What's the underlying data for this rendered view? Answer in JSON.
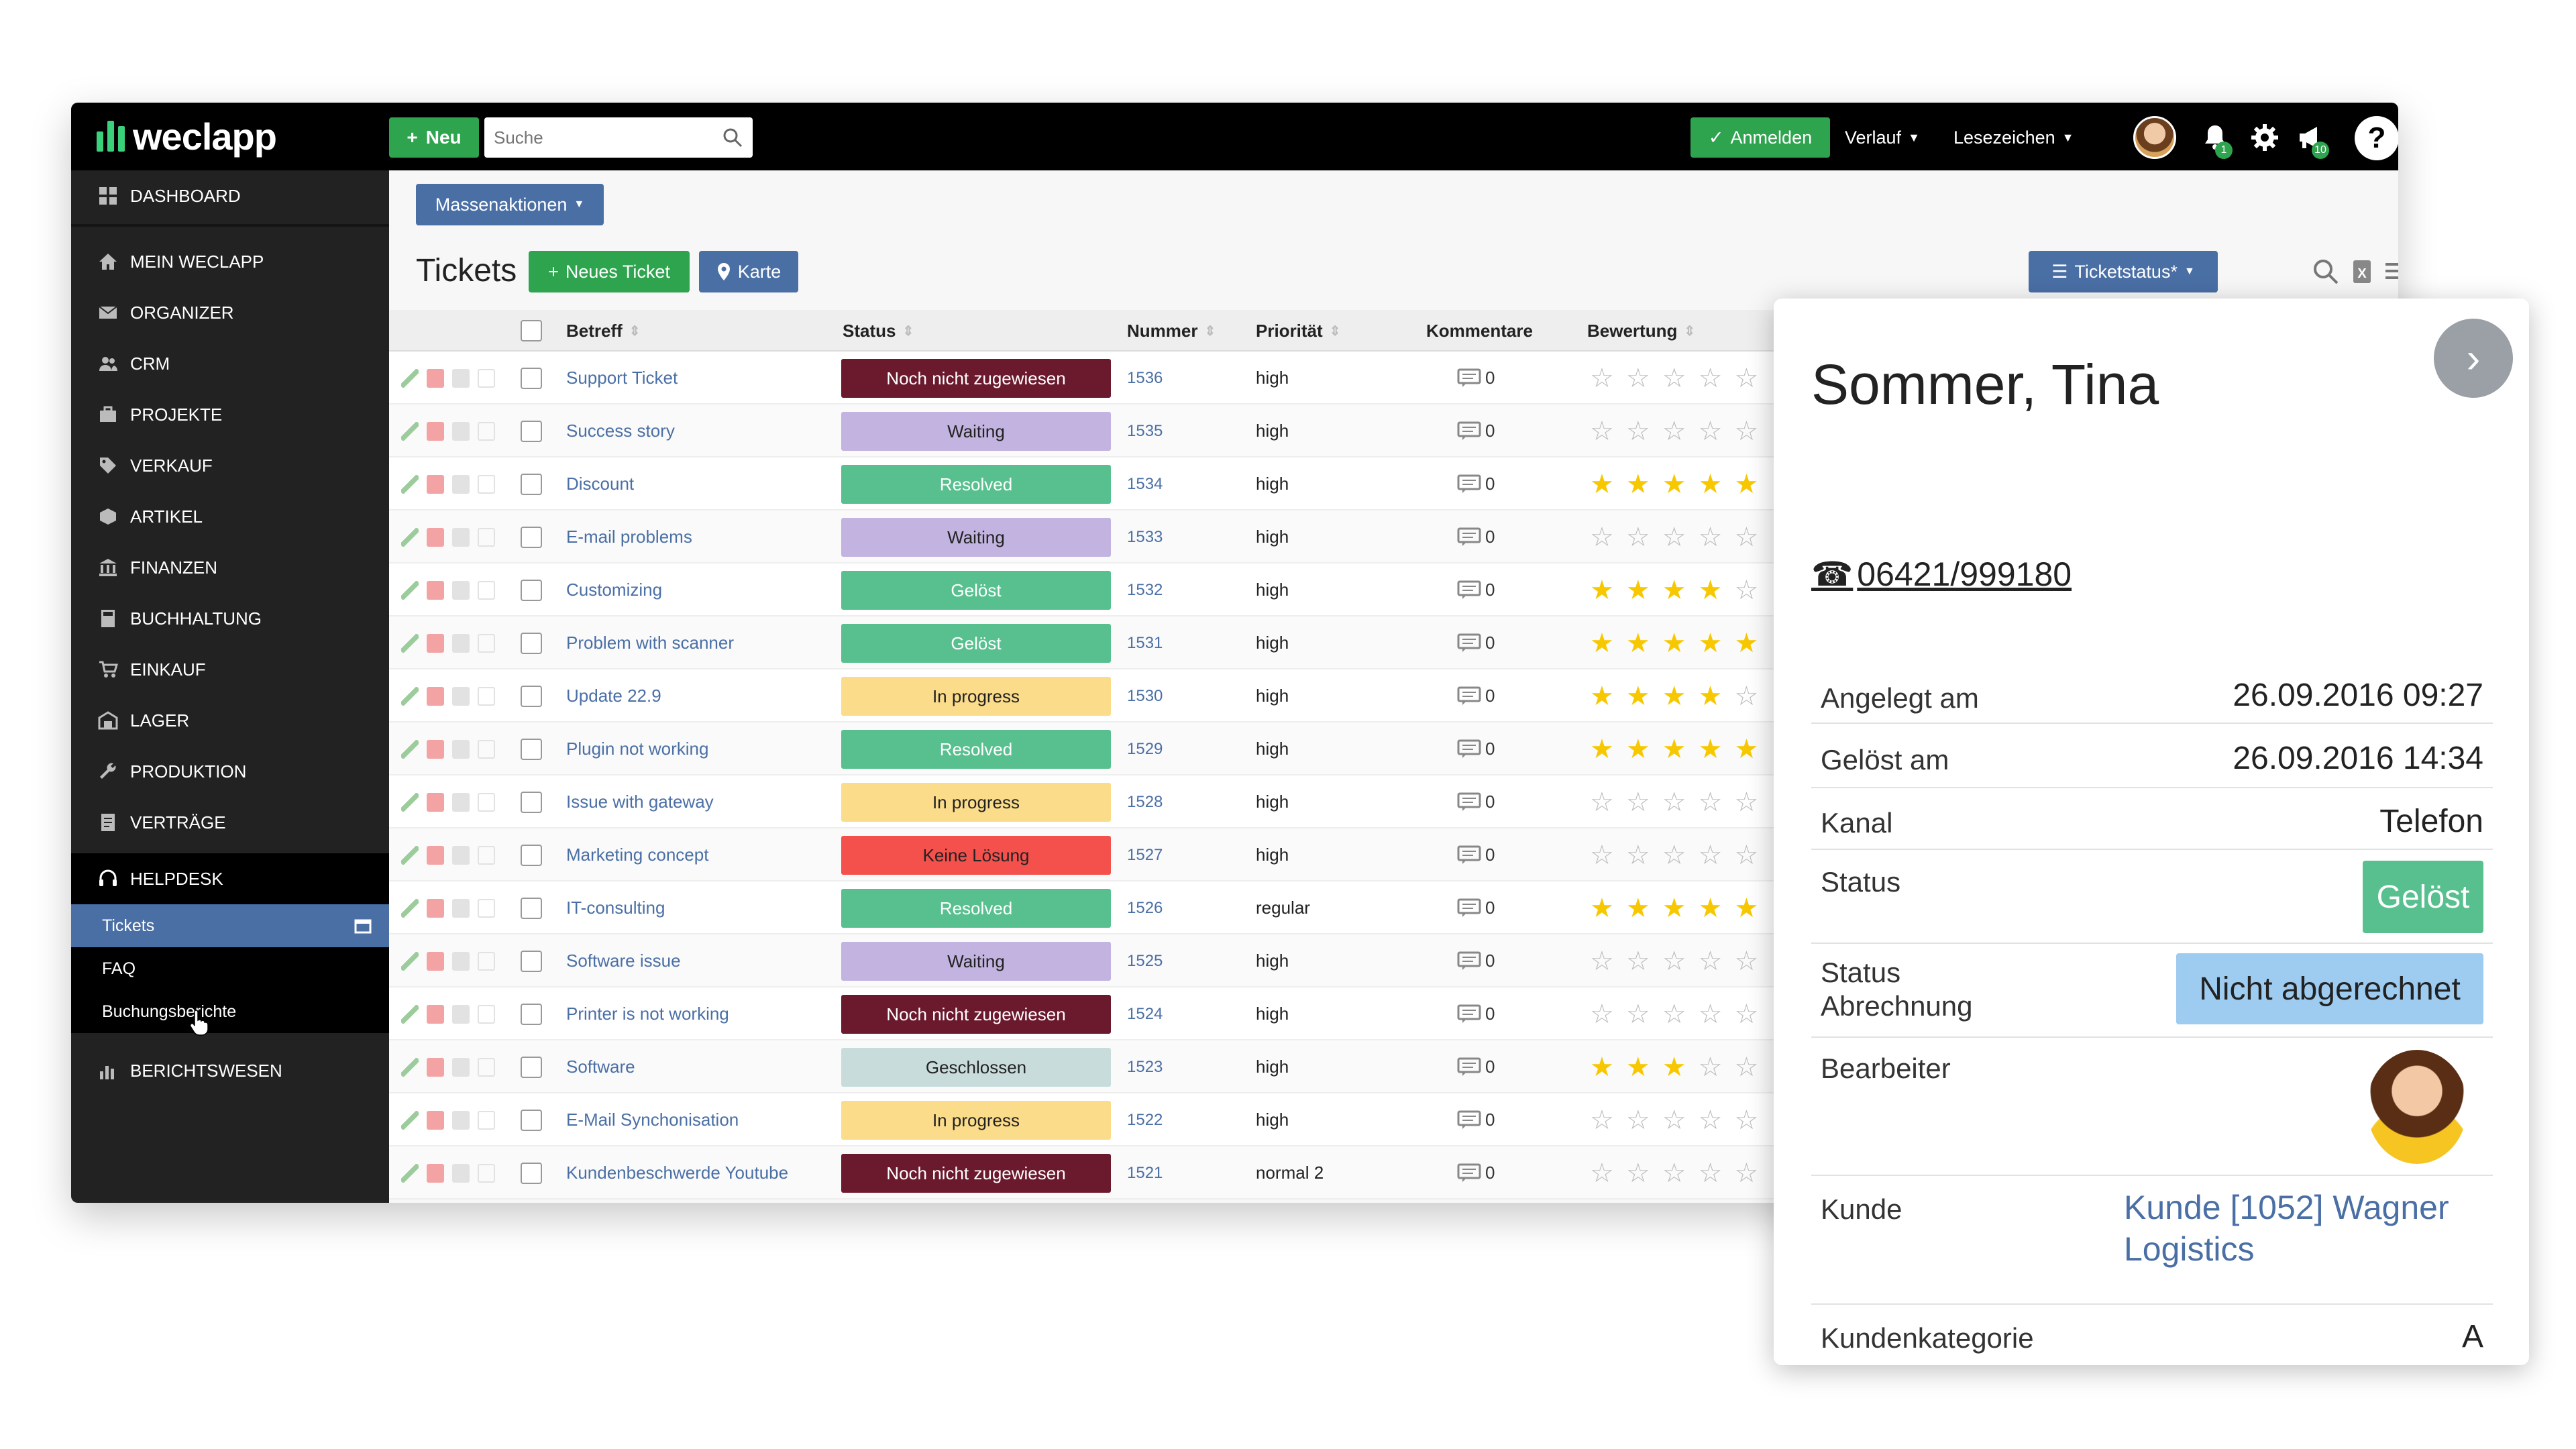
{
  "brand": {
    "name": "weclapp",
    "accent_green": "#2ea44f",
    "accent_blue": "#4a6fa5"
  },
  "topbar": {
    "new_label": "Neu",
    "search_placeholder": "Suche",
    "login_label": "Anmelden",
    "history_label": "Verlauf",
    "bookmarks_label": "Lesezeichen",
    "notifications_badge": "1",
    "announcements_badge": "10",
    "help_label": "?"
  },
  "sidebar": {
    "items": [
      {
        "label": "DASHBOARD",
        "icon": "dashboard-icon"
      },
      {
        "label": "MEIN WECLAPP",
        "icon": "home-icon"
      },
      {
        "label": "ORGANIZER",
        "icon": "mail-icon"
      },
      {
        "label": "CRM",
        "icon": "users-icon"
      },
      {
        "label": "PROJEKTE",
        "icon": "briefcase-icon"
      },
      {
        "label": "VERKAUF",
        "icon": "tag-icon"
      },
      {
        "label": "ARTIKEL",
        "icon": "box-icon"
      },
      {
        "label": "FINANZEN",
        "icon": "bank-icon"
      },
      {
        "label": "BUCHHALTUNG",
        "icon": "calculator-icon"
      },
      {
        "label": "EINKAUF",
        "icon": "cart-icon"
      },
      {
        "label": "LAGER",
        "icon": "warehouse-icon"
      },
      {
        "label": "PRODUKTION",
        "icon": "wrench-icon"
      },
      {
        "label": "VERTRÄGE",
        "icon": "contract-icon"
      },
      {
        "label": "HELPDESK",
        "icon": "headset-icon"
      },
      {
        "label": "BERICHTSWESEN",
        "icon": "chart-icon"
      }
    ],
    "helpdesk_sub": [
      {
        "label": "Tickets",
        "active": true
      },
      {
        "label": "FAQ",
        "active": false
      },
      {
        "label": "Buchungsberichte",
        "active": false
      }
    ]
  },
  "main": {
    "bulk_actions_label": "Massenaktionen",
    "title": "Tickets",
    "new_ticket_label": "Neues Ticket",
    "map_label": "Karte",
    "filter_label": "Ticketstatus*",
    "columns": [
      "Betreff",
      "Status",
      "Nummer",
      "Priorität",
      "Kommentare",
      "Bewertung"
    ],
    "rows": [
      {
        "subject": "Support Ticket",
        "status": "Noch nicht zugewiesen",
        "status_color": "#6b1a2e",
        "status_text_color": "#ffffff",
        "number": "1536",
        "priority": "high",
        "comments": "0",
        "rating": 0
      },
      {
        "subject": "Success story",
        "status": "Waiting",
        "status_color": "#c3b3e0",
        "status_text_color": "#222222",
        "number": "1535",
        "priority": "high",
        "comments": "0",
        "rating": 0
      },
      {
        "subject": "Discount",
        "status": "Resolved",
        "status_color": "#58c08f",
        "status_text_color": "#ffffff",
        "number": "1534",
        "priority": "high",
        "comments": "0",
        "rating": 5
      },
      {
        "subject": "E-mail problems",
        "status": "Waiting",
        "status_color": "#c3b3e0",
        "status_text_color": "#222222",
        "number": "1533",
        "priority": "high",
        "comments": "0",
        "rating": 0
      },
      {
        "subject": "Customizing",
        "status": "Gelöst",
        "status_color": "#58c08f",
        "status_text_color": "#ffffff",
        "number": "1532",
        "priority": "high",
        "comments": "0",
        "rating": 4
      },
      {
        "subject": "Problem with scanner",
        "status": "Gelöst",
        "status_color": "#58c08f",
        "status_text_color": "#ffffff",
        "number": "1531",
        "priority": "high",
        "comments": "0",
        "rating": 5
      },
      {
        "subject": "Update 22.9",
        "status": "In progress",
        "status_color": "#fbdc8a",
        "status_text_color": "#222222",
        "number": "1530",
        "priority": "high",
        "comments": "0",
        "rating": 4
      },
      {
        "subject": "Plugin not working",
        "status": "Resolved",
        "status_color": "#58c08f",
        "status_text_color": "#ffffff",
        "number": "1529",
        "priority": "high",
        "comments": "0",
        "rating": 5
      },
      {
        "subject": "Issue with gateway",
        "status": "In progress",
        "status_color": "#fbdc8a",
        "status_text_color": "#222222",
        "number": "1528",
        "priority": "high",
        "comments": "0",
        "rating": 0
      },
      {
        "subject": "Marketing concept",
        "status": "Keine Lösung",
        "status_color": "#f4504c",
        "status_text_color": "#222222",
        "number": "1527",
        "priority": "high",
        "comments": "0",
        "rating": 0
      },
      {
        "subject": "IT-consulting",
        "status": "Resolved",
        "status_color": "#58c08f",
        "status_text_color": "#ffffff",
        "number": "1526",
        "priority": "regular",
        "comments": "0",
        "rating": 5
      },
      {
        "subject": "Software issue",
        "status": "Waiting",
        "status_color": "#c3b3e0",
        "status_text_color": "#222222",
        "number": "1525",
        "priority": "high",
        "comments": "0",
        "rating": 0
      },
      {
        "subject": "Printer is not working",
        "status": "Noch nicht zugewiesen",
        "status_color": "#6b1a2e",
        "status_text_color": "#ffffff",
        "number": "1524",
        "priority": "high",
        "comments": "0",
        "rating": 0
      },
      {
        "subject": "Software",
        "status": "Geschlossen",
        "status_color": "#c9dcdc",
        "status_text_color": "#222222",
        "number": "1523",
        "priority": "high",
        "comments": "0",
        "rating": 3
      },
      {
        "subject": "E-Mail Synchonisation",
        "status": "In progress",
        "status_color": "#fbdc8a",
        "status_text_color": "#222222",
        "number": "1522",
        "priority": "high",
        "comments": "0",
        "rating": 0
      },
      {
        "subject": "Kundenbeschwerde Youtube",
        "status": "Noch nicht zugewiesen",
        "status_color": "#6b1a2e",
        "status_text_color": "#ffffff",
        "number": "1521",
        "priority": "normal 2",
        "comments": "0",
        "rating": 0
      }
    ]
  },
  "detail": {
    "name": "Sommer, Tina",
    "phone": "06421/999180",
    "fields": {
      "created_label": "Angelegt am",
      "created_value": "26.09.2016 09:27",
      "solved_label": "Gelöst am",
      "solved_value": "26.09.2016 14:34",
      "channel_label": "Kanal",
      "channel_value": "Telefon",
      "status_label": "Status",
      "status_value": "Gelöst",
      "billing_label_1": "Status",
      "billing_label_2": "Abrechnung",
      "billing_value": "Nicht abgerechnet",
      "agent_label": "Bearbeiter",
      "customer_label": "Kunde",
      "customer_value_1": "Kunde [1052] Wagner",
      "customer_value_2": "Logistics",
      "category_label": "Kundenkategorie",
      "category_value": "A"
    }
  }
}
